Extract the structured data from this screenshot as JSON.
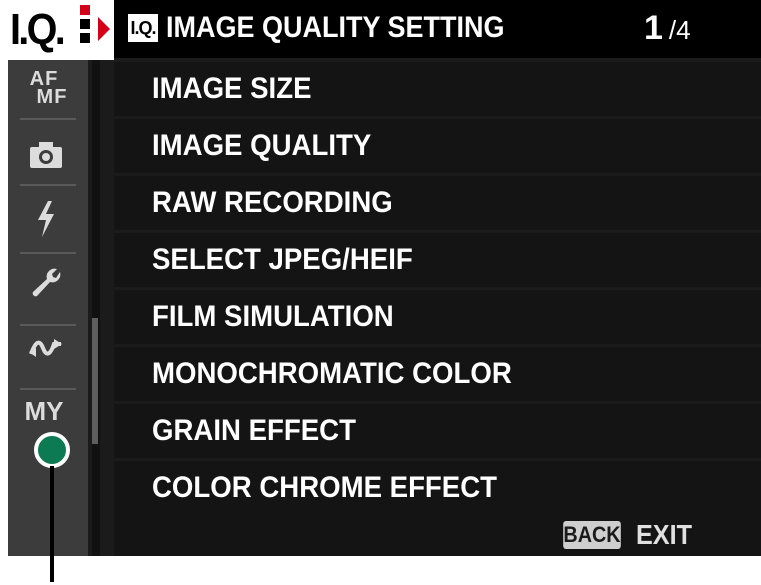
{
  "sidebar": {
    "active_tab": {
      "label": "I.Q.",
      "icon": "image-quality-icon"
    },
    "tabs": [
      {
        "label": "AF MF",
        "line1": "AF",
        "line2": "MF",
        "icon": "af-mf-icon"
      },
      {
        "label": "",
        "icon": "camera-icon"
      },
      {
        "label": "",
        "icon": "flash-icon"
      },
      {
        "label": "",
        "icon": "wrench-icon"
      },
      {
        "label": "",
        "icon": "connection-icon"
      },
      {
        "label": "MY",
        "icon": "my-menu-icon"
      }
    ],
    "scroll_position": 0.55
  },
  "header": {
    "badge": "I.Q.",
    "title": "IMAGE QUALITY SETTING",
    "page_current": "1",
    "page_total": "/4"
  },
  "menu": {
    "items": [
      "IMAGE SIZE",
      "IMAGE QUALITY",
      "RAW RECORDING",
      "SELECT JPEG/HEIF",
      "FILM SIMULATION",
      "MONOCHROMATIC COLOR",
      "GRAIN EFFECT",
      "COLOR CHROME EFFECT"
    ]
  },
  "footer": {
    "back_key": "BACK",
    "exit_label": "EXIT"
  },
  "colors": {
    "accent_red": "#d4001a",
    "callout_green": "#0c7a52"
  }
}
